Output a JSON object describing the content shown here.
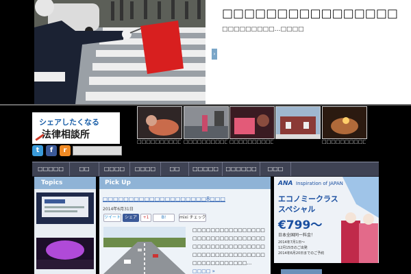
{
  "hero": {
    "title": "□□□□□□□□□□□□□□□□",
    "subtitle": "□□□□□□□□□…□□□□",
    "next_arrow": "›"
  },
  "logo": {
    "line1": "シェアしたくなる",
    "line2": "法律相談所"
  },
  "social": {
    "twitter": "t",
    "facebook": "f",
    "rss": "r"
  },
  "thumbnails": [
    {
      "caption": "□□□□□□□□□□□□□□□□"
    },
    {
      "caption": "□□□□□□□□□□□□□□□□"
    },
    {
      "caption": "□□□□□□□□□□□□□□□□"
    },
    {
      "caption": ""
    },
    {
      "caption": "□□□□□□□□□□□□□□□□"
    }
  ],
  "nav": [
    "□□□□□",
    "□□",
    "□□□□",
    "□□□□",
    "□□",
    "□□□□□",
    "□□□□□□",
    "□□□"
  ],
  "topics": {
    "heading": "Topics"
  },
  "pickup": {
    "heading": "Pick Up",
    "article_title": "□□□□□□□□□□□□□□□□□□□□8□□□",
    "date": "2014年6月31日",
    "buttons": {
      "tweet": "ツイート",
      "share": "シェア",
      "plus": "+1",
      "hatena": "B!",
      "mixi": "mixi チェック"
    },
    "body": "□□□□□□□□□□□□□□□□□□□□□□□□□□□□□□□□□□□□□□□□□□□□□□□□□□□□□□□□□□□□□□□□□□□□□□□□□□□□…",
    "readmore": "□□□□ »"
  },
  "ad": {
    "brand": "ANA",
    "inspiration": "Inspiration of JAPAN",
    "headline1": "エコノミークラス",
    "headline2": "スペシャル",
    "price": "€799〜",
    "note": "日本全国同一料金！",
    "dates": "2014年7月1日〜\n12月15日のご出発\n2014年6月20日までのご予約"
  }
}
